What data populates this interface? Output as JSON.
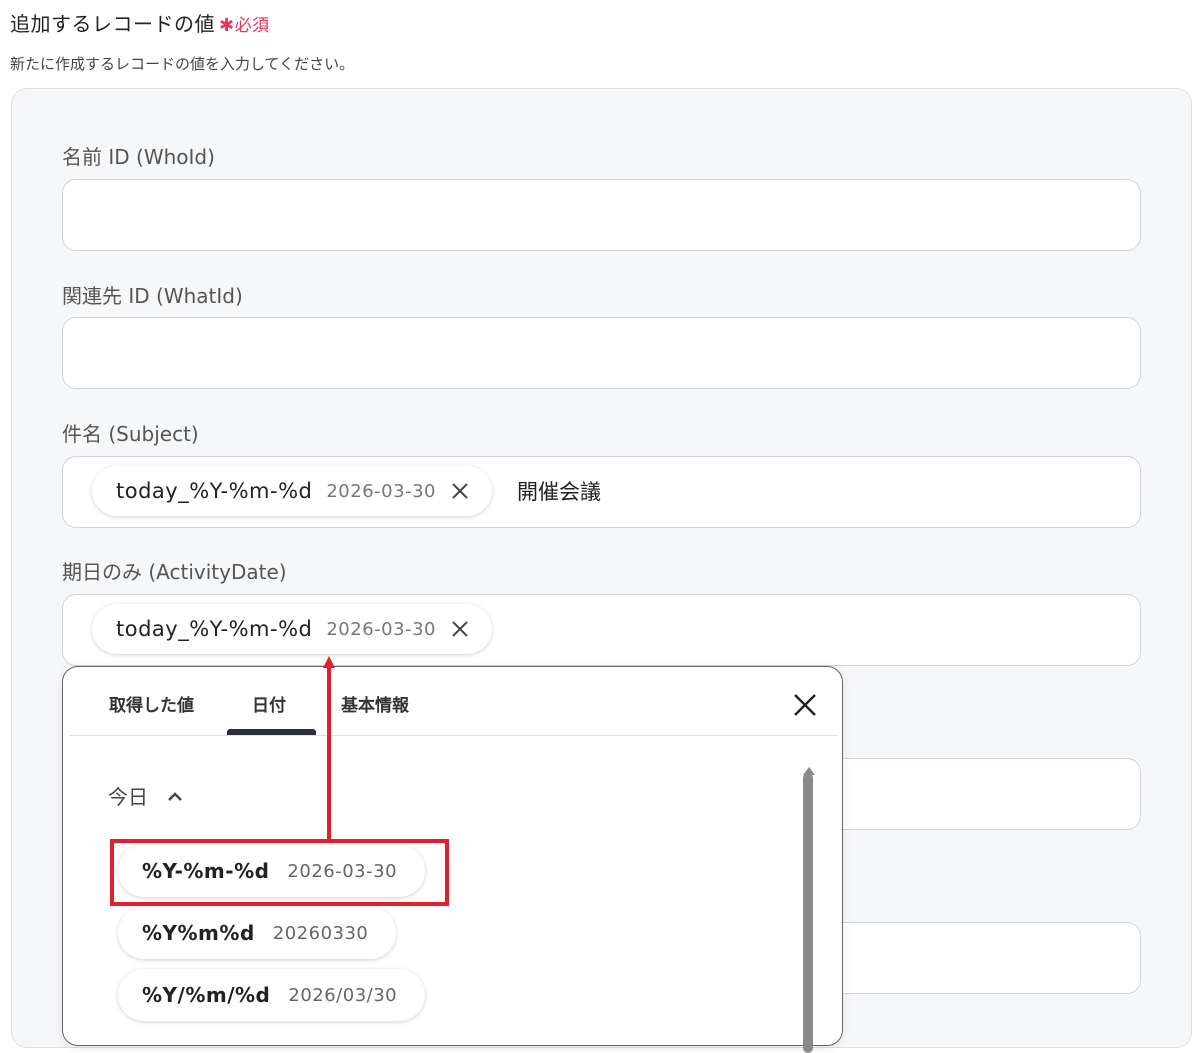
{
  "section": {
    "title": "追加するレコードの値",
    "required_mark": "✱",
    "required_text": "必須",
    "description": "新たに作成するレコードの値を入力してください。"
  },
  "fields": {
    "whoid_label": "名前 ID (WhoId)",
    "whatid_label": "関連先 ID (WhatId)",
    "subject_label": "件名 (Subject)",
    "subject_chip_name": "today_%Y-%m-%d",
    "subject_chip_value": "2026-03-30",
    "subject_after_text": "開催会議",
    "activitydate_label": "期日のみ (ActivityDate)",
    "activitydate_chip_name": "today_%Y-%m-%d",
    "activitydate_chip_value": "2026-03-30"
  },
  "popup": {
    "tabs": [
      "取得した値",
      "日付",
      "基本情報"
    ],
    "active_tab": "日付",
    "group_label": "今日",
    "options": [
      {
        "name": "%Y-%m-%d",
        "value": "2026-03-30"
      },
      {
        "name": "%Y%m%d",
        "value": "20260330"
      },
      {
        "name": "%Y/%m/%d",
        "value": "2026/03/30"
      }
    ]
  },
  "colors": {
    "accent_red": "#e0202d",
    "required_pink": "#e8365d",
    "panel_bg": "#f6f7f9"
  },
  "icons": {
    "chip_close": "close-icon",
    "popup_close": "close-icon",
    "group_toggle": "chevron-up-icon"
  }
}
